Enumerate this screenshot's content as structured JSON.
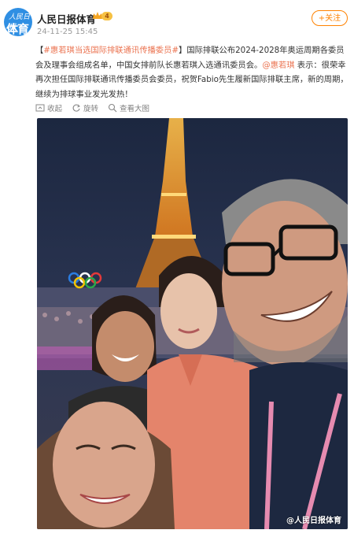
{
  "account": {
    "avatar_line1": "人民日报",
    "avatar_line2": "体育",
    "name": "人民日报体育",
    "vip_level": "4",
    "date": "24-11-25 15:45",
    "follow_label": "+关注"
  },
  "post": {
    "open_bracket": "【",
    "hashtag": "#惠若琪当选国际排联通讯传播委员#",
    "close_bracket": "】",
    "body": "国际排联公布2024-2028年奥运周期各委员会及理事会组成名单，中国女排前队长惠若琪入选通讯委员会。",
    "mention": "@惠若琪",
    "quote": " 表示：很荣幸再次担任国际排联通讯传播委员会委员，祝贺Fabio先生履新国际排联主席，新的周期，继续为排球事业发光发热！"
  },
  "actions": {
    "collapse": "收起",
    "rotate": "旋转",
    "view_large": "查看大图"
  },
  "photo": {
    "watermark": "@人民日报体育"
  }
}
